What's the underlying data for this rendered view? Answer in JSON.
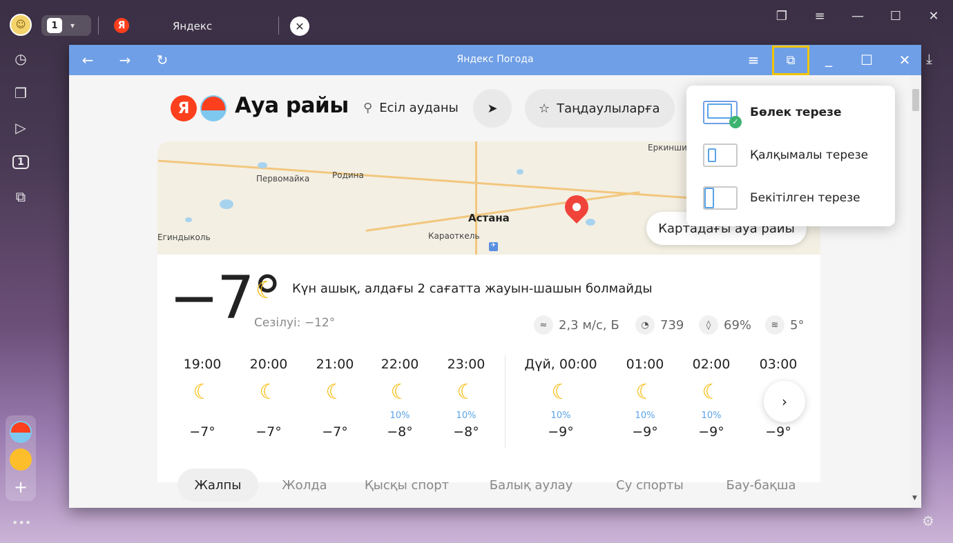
{
  "browser": {
    "tab_count": "1",
    "tab_title": "Яндекс",
    "tab_favicon": "Я",
    "close_glyph": "✕"
  },
  "window": {
    "title": "Яндекс Погода",
    "controls": {
      "back": "←",
      "forward": "→",
      "reload": "↻",
      "menu": "≡",
      "minimize": "_",
      "maximize": "☐",
      "close": "✕"
    }
  },
  "weather": {
    "logo_letter": "Я",
    "brand": "Ауа райы",
    "search_text": "Есіл ауданы",
    "favorites_label": "Таңдаулыларға",
    "map": {
      "button": "Картадағы ауа райы",
      "towns": [
        "Первомайка",
        "Родина",
        "Астана",
        "Караоткель",
        "Егиндыколь",
        "Еркиншилик"
      ]
    },
    "now": {
      "temp": "−7°",
      "condition": "Күн ашық, алдағы 2 сағатта жауын-шашын болмайды",
      "feels": "Сезілуі: −12°",
      "wind": "2,3 м/с, Б",
      "pressure": "739",
      "humidity": "69%",
      "water": "5°"
    },
    "hourly": [
      {
        "time": "19:00",
        "prec": "",
        "temp": "−7°"
      },
      {
        "time": "20:00",
        "prec": "",
        "temp": "−7°"
      },
      {
        "time": "21:00",
        "prec": "",
        "temp": "−7°"
      },
      {
        "time": "22:00",
        "prec": "10%",
        "temp": "−8°"
      },
      {
        "time": "23:00",
        "prec": "10%",
        "temp": "−8°"
      },
      {
        "time": "Дүй, 00:00",
        "prec": "10%",
        "temp": "−9°"
      },
      {
        "time": "01:00",
        "prec": "10%",
        "temp": "−9°"
      },
      {
        "time": "02:00",
        "prec": "10%",
        "temp": "−9°"
      },
      {
        "time": "03:00",
        "prec": "",
        "temp": "−9°"
      }
    ],
    "tabs": [
      "Жалпы",
      "Жолда",
      "Қысқы спорт",
      "Балық аулау",
      "Су спорты",
      "Бау-бақша"
    ]
  },
  "menu": {
    "items": [
      "Бөлек терезе",
      "Қалқымалы терезе",
      "Бекітілген терезе"
    ]
  },
  "colors": {
    "accent": "#f5c400",
    "window_bar": "#6f9fe6",
    "yandex_red": "#fc3f1d",
    "moon": "#f6b800"
  }
}
